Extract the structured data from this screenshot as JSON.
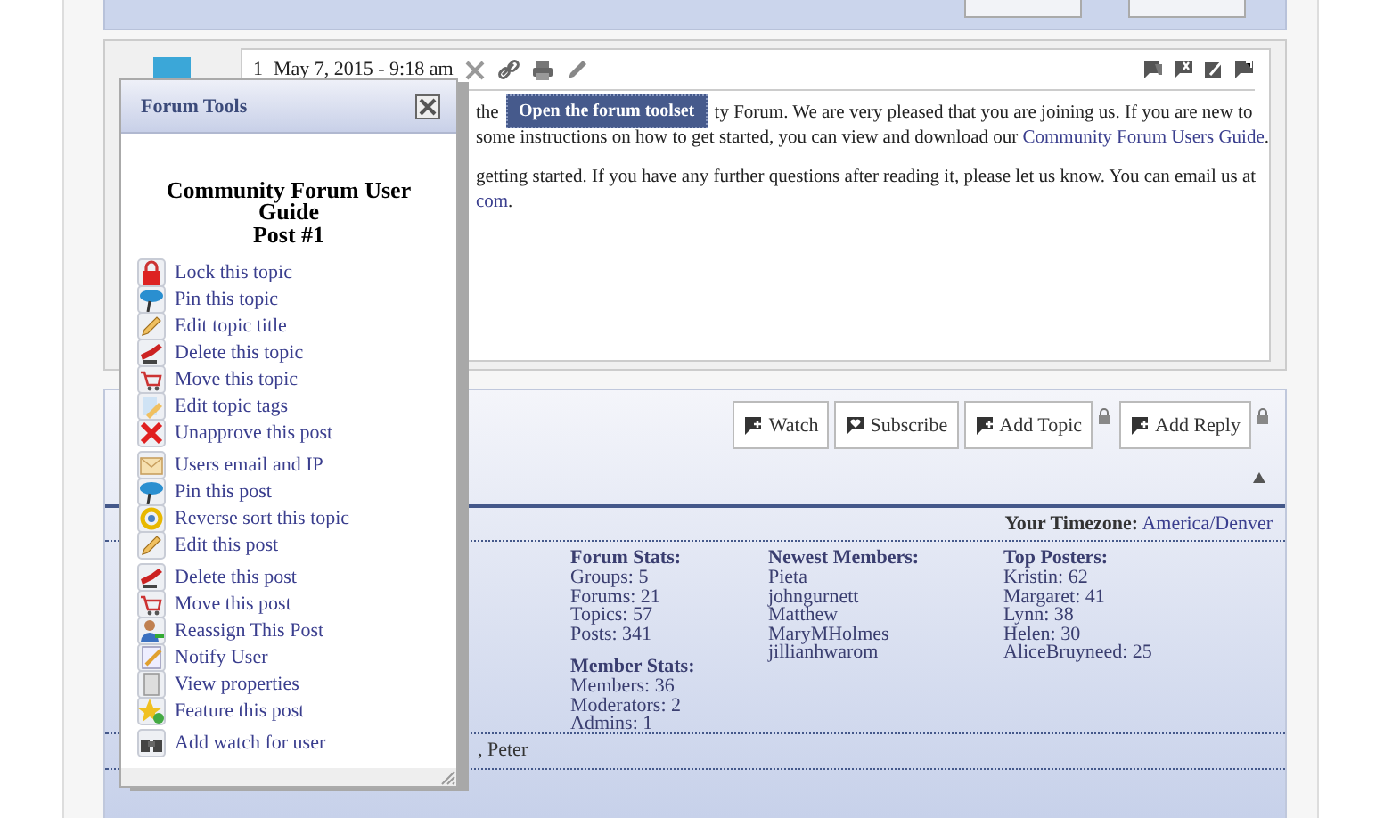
{
  "post": {
    "number": "1",
    "date": "May 7, 2015 - 9:18 am",
    "lines": [
      {
        "parts": [
          {
            "text": "the",
            "kind": "text"
          },
          {
            "text": "ty Forum.  We are very pleased that you are joining us.  If you are new to",
            "kind": "gapped"
          }
        ]
      },
      {
        "parts": [
          {
            "text": "some instructions on how to get started, you can view and download our ",
            "kind": "text"
          },
          {
            "text": "Community Forum Users Guide",
            "kind": "link"
          },
          {
            "text": ".",
            "kind": "text"
          }
        ]
      },
      {
        "parts": [
          {
            "text": "getting started.  If you have any further questions after reading it, please let us know.  You can email us at",
            "kind": "text"
          }
        ]
      },
      {
        "parts": [
          {
            "text": "com",
            "kind": "link"
          },
          {
            "text": ".",
            "kind": "text"
          }
        ]
      }
    ]
  },
  "tooltip": "Open the forum toolset",
  "toolbar": {
    "buttons": [
      {
        "label": "Watch",
        "locked": false
      },
      {
        "label": "Subscribe",
        "locked": false
      },
      {
        "label": "Add Topic",
        "locked": true
      },
      {
        "label": "Add Reply",
        "locked": true
      }
    ]
  },
  "timezone": {
    "label": "Your Timezone:",
    "value": "America/Denver"
  },
  "stats": [
    {
      "groups": [
        {
          "heading": "Forum Stats:",
          "items": [
            "Groups: 5",
            "Forums: 21",
            "Topics: 57",
            "Posts: 341"
          ]
        },
        {
          "heading": "Member Stats:",
          "items": [
            "Members: 36",
            "Moderators: 2",
            "Admins: 1"
          ]
        }
      ]
    },
    {
      "groups": [
        {
          "heading": "Newest Members:",
          "items": [
            "Pieta",
            "johngurnett",
            "Matthew",
            "MaryMHolmes",
            "jillianhwarom"
          ]
        }
      ]
    },
    {
      "groups": [
        {
          "heading": "Top Posters:",
          "items": [
            "Kristin: 62",
            "Margaret: 41",
            "Lynn: 38",
            "Helen: 30",
            "AliceBruyneed: 25"
          ]
        }
      ]
    }
  ],
  "online_fragment": ", Peter",
  "forum_tools": {
    "title": "Forum Tools",
    "heading": "Community Forum User Guide",
    "subheading": "Post #1",
    "groups": [
      [
        "Lock this topic",
        "Pin this topic",
        "Edit topic title",
        "Delete this topic",
        "Move this topic",
        "Edit topic tags",
        "Unapprove this post"
      ],
      [
        "Users email and IP",
        "Pin this post",
        "Reverse sort this topic",
        "Edit this post"
      ],
      [
        "Delete this post",
        "Move this post",
        "Reassign This Post",
        "Notify User",
        "View properties",
        "Feature this post"
      ],
      [
        "Add watch for user"
      ]
    ]
  }
}
